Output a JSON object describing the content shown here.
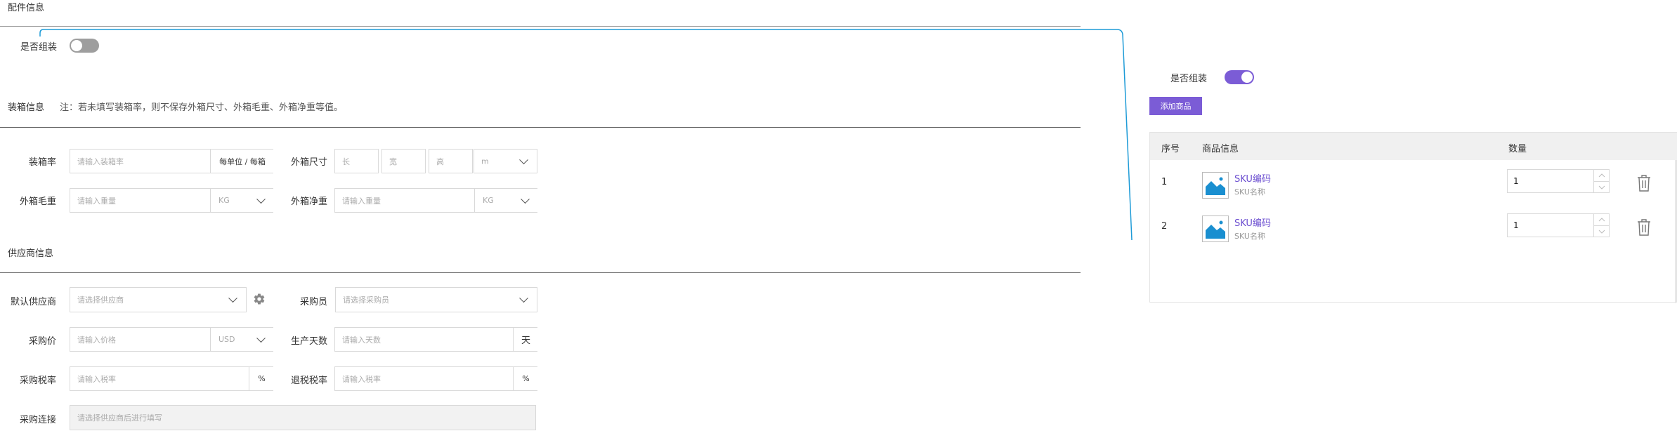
{
  "sections": {
    "accessory": "配件信息",
    "packing": "装箱信息",
    "packing_note": "注：若未填写装箱率，则不保存外箱尺寸、外箱毛重、外箱净重等值。",
    "supplier": "供应商信息"
  },
  "assembly": {
    "label": "是否组装",
    "left_on": false,
    "right_on": true
  },
  "packing": {
    "rate_label": "装箱率",
    "rate_placeholder": "请输入装箱率",
    "rate_unit": "每单位 / 每箱",
    "size_label": "外箱尺寸",
    "size_l": "长",
    "size_w": "宽",
    "size_h": "高",
    "size_unit": "m",
    "gross_label": "外箱毛重",
    "gross_placeholder": "请输入重量",
    "gross_unit": "KG",
    "net_label": "外箱净重",
    "net_placeholder": "请输入重量",
    "net_unit": "KG"
  },
  "supplier": {
    "default_label": "默认供应商",
    "default_placeholder": "请选择供应商",
    "buyer_label": "采购员",
    "buyer_placeholder": "请选择采购员",
    "price_label": "采购价",
    "price_placeholder": "请输入价格",
    "price_currency": "USD",
    "days_label": "生产天数",
    "days_placeholder": "请输入天数",
    "days_unit": "天",
    "tax_label": "采购税率",
    "tax_placeholder": "请输入税率",
    "tax_unit": "%",
    "refund_label": "退税税率",
    "refund_placeholder": "请输入税率",
    "refund_unit": "%",
    "link_label": "采购连接",
    "link_placeholder": "请选择供应商后进行填写"
  },
  "panel": {
    "add_button": "添加商品",
    "columns": {
      "index": "序号",
      "info": "商品信息",
      "qty": "数量"
    },
    "rows": [
      {
        "index": "1",
        "sku_code": "SKU编码",
        "sku_name": "SKU名称",
        "qty": "1"
      },
      {
        "index": "2",
        "sku_code": "SKU编码",
        "sku_name": "SKU名称",
        "qty": "1"
      }
    ]
  },
  "colors": {
    "accent": "#7b5cd6",
    "connector": "#1e9bd7",
    "toggle_off": "#9e9e9e"
  }
}
